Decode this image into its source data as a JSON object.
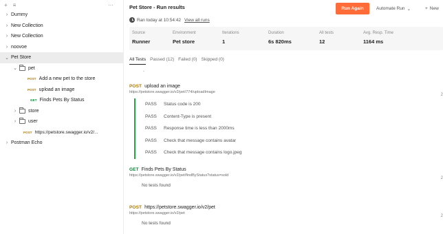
{
  "sidebar": {
    "toolbar": {
      "add": "+",
      "filter": "≡",
      "more": "···"
    },
    "items": [
      {
        "label": "Dummy"
      },
      {
        "label": "New Collection"
      },
      {
        "label": "New Collection"
      },
      {
        "label": "noovoe"
      },
      {
        "label": "Pet Store"
      },
      {
        "label": "pet"
      },
      {
        "method": "POST",
        "label": "Add a new pet to the store"
      },
      {
        "method": "POST",
        "label": "upload an image"
      },
      {
        "method": "GET",
        "label": "Finds Pets By Status"
      },
      {
        "label": "store"
      },
      {
        "label": "user"
      },
      {
        "method": "POST",
        "label": "https://petstore.swagger.io/v2/..."
      },
      {
        "label": "Postman Echo"
      }
    ]
  },
  "header": {
    "title": "Pet Store - Run results",
    "run_info": "Ran today at 10:54:42",
    "view_all": "View all runs",
    "run_again": "Run Again",
    "automate": "Automate Run",
    "new_label": "New"
  },
  "stats": [
    {
      "label": "Source",
      "value": "Runner"
    },
    {
      "label": "Environment",
      "value": "Pet store"
    },
    {
      "label": "Iterations",
      "value": "1"
    },
    {
      "label": "Duration",
      "value": "6s 820ms"
    },
    {
      "label": "All tests",
      "value": "12"
    },
    {
      "label": "Avg. Resp. Time",
      "value": "1164 ms"
    }
  ],
  "tabs": [
    {
      "label": "All Tests"
    },
    {
      "label": "Passed (12)"
    },
    {
      "label": "Failed (0)"
    },
    {
      "label": "Skipped (0)"
    }
  ],
  "dash": "-",
  "requests": [
    {
      "method": "POST",
      "name": "upload an image",
      "url": "https://petstore.swagger.io/v2/pet/774/uploadImage",
      "edge": "2",
      "results": [
        {
          "status": "PASS",
          "text": "Status code is 200"
        },
        {
          "status": "PASS",
          "text": "Content-Type is present"
        },
        {
          "status": "PASS",
          "text": "Response time is less than 2000ms"
        },
        {
          "status": "PASS",
          "text": "Check that message contains avatar"
        },
        {
          "status": "PASS",
          "text": "Check that message contains logo.jpeg"
        }
      ]
    },
    {
      "method": "GET",
      "name": "Finds Pets By Status",
      "url": "https://petstore.swagger.io/v2/pet/findByStatus?status=sold",
      "edge": "2",
      "no_tests": "No tests found"
    },
    {
      "method": "POST",
      "name": "https://petstore.swagger.io/v2/pet",
      "url": "https://petstore.swagger.io/v2/pet",
      "edge": "2",
      "no_tests": "No tests found"
    }
  ],
  "colors": {
    "accent": "#ff6c37",
    "post": "#ad7a03",
    "get": "#007f31",
    "pass_bar": "#27a046"
  }
}
